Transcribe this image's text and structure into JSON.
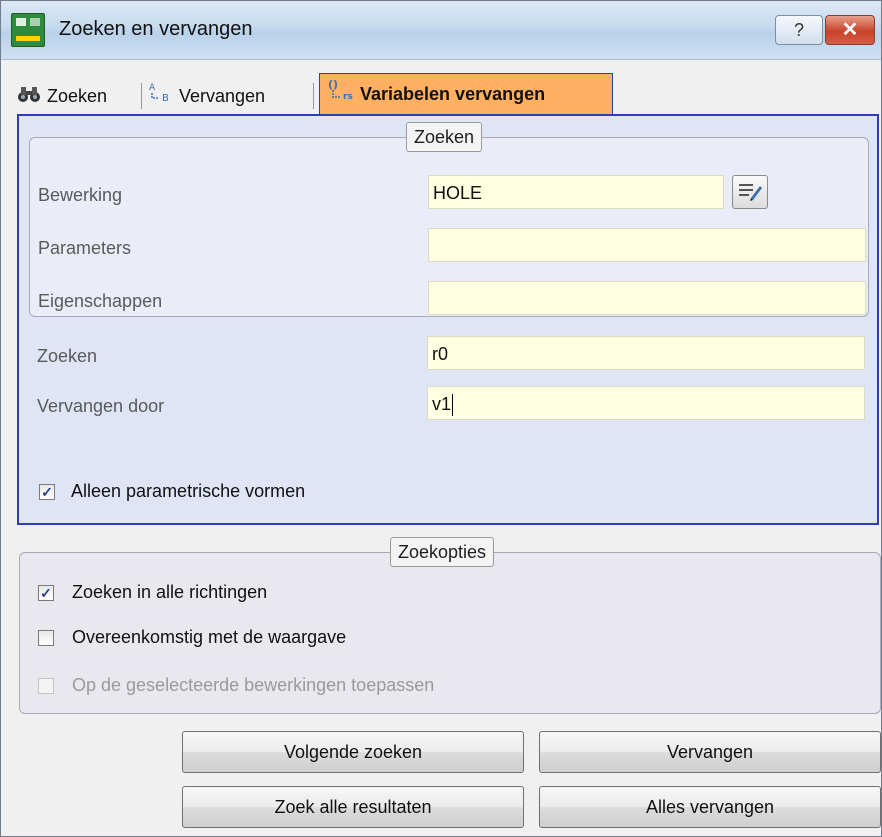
{
  "window": {
    "title": "Zoeken en vervangen",
    "help_label": "?",
    "close_label": "✕"
  },
  "tabs": [
    {
      "label": "Zoeken"
    },
    {
      "label": "Vervangen"
    },
    {
      "label": "Variabelen vervangen"
    }
  ],
  "search_group": {
    "title": "Zoeken",
    "rows": [
      {
        "label": "Bewerking",
        "value": "HOLE"
      },
      {
        "label": "Parameters",
        "value": ""
      },
      {
        "label": "Eigenschappen",
        "value": ""
      }
    ]
  },
  "find": {
    "label": "Zoeken",
    "value": "r0"
  },
  "replace": {
    "label": "Vervangen door",
    "value": "v1"
  },
  "parametric_only": {
    "label": "Alleen parametrische vormen",
    "checked": true
  },
  "options": {
    "title": "Zoekopties",
    "items": [
      {
        "label": "Zoeken in alle richtingen",
        "checked": true,
        "enabled": true
      },
      {
        "label": "Overeenkomstig met de waargave",
        "checked": false,
        "enabled": true
      },
      {
        "label": "Op de geselecteerde bewerkingen toepassen",
        "checked": false,
        "enabled": false
      }
    ]
  },
  "buttons": {
    "find_next": "Volgende zoeken",
    "replace": "Vervangen",
    "find_all": "Zoek alle resultaten",
    "replace_all": "Alles vervangen"
  },
  "colors": {
    "active_tab": "#ffb060",
    "panel_border": "#2f3fb0",
    "field_bg": "#ffffe1"
  }
}
